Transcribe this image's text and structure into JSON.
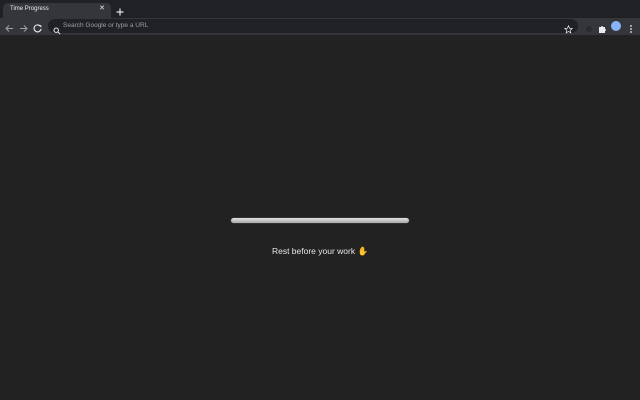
{
  "tab": {
    "title": "Time Progress",
    "close_icon": "close-icon"
  },
  "new_tab_icon": "plus-icon",
  "toolbar": {
    "back_icon": "back-arrow-icon",
    "forward_icon": "forward-arrow-icon",
    "reload_icon": "reload-icon",
    "search_placeholder": "Search Google or type a URL",
    "bookmark_icon": "star-icon",
    "extensions_icon": "puzzle-icon",
    "menu_icon": "kebab-menu-icon"
  },
  "page": {
    "progress_fraction": 1.0,
    "message": "Rest before your work ✋"
  },
  "colors": {
    "page_background": "#222222",
    "tab_background": "#35363a",
    "accent": "#8ab4f8"
  }
}
